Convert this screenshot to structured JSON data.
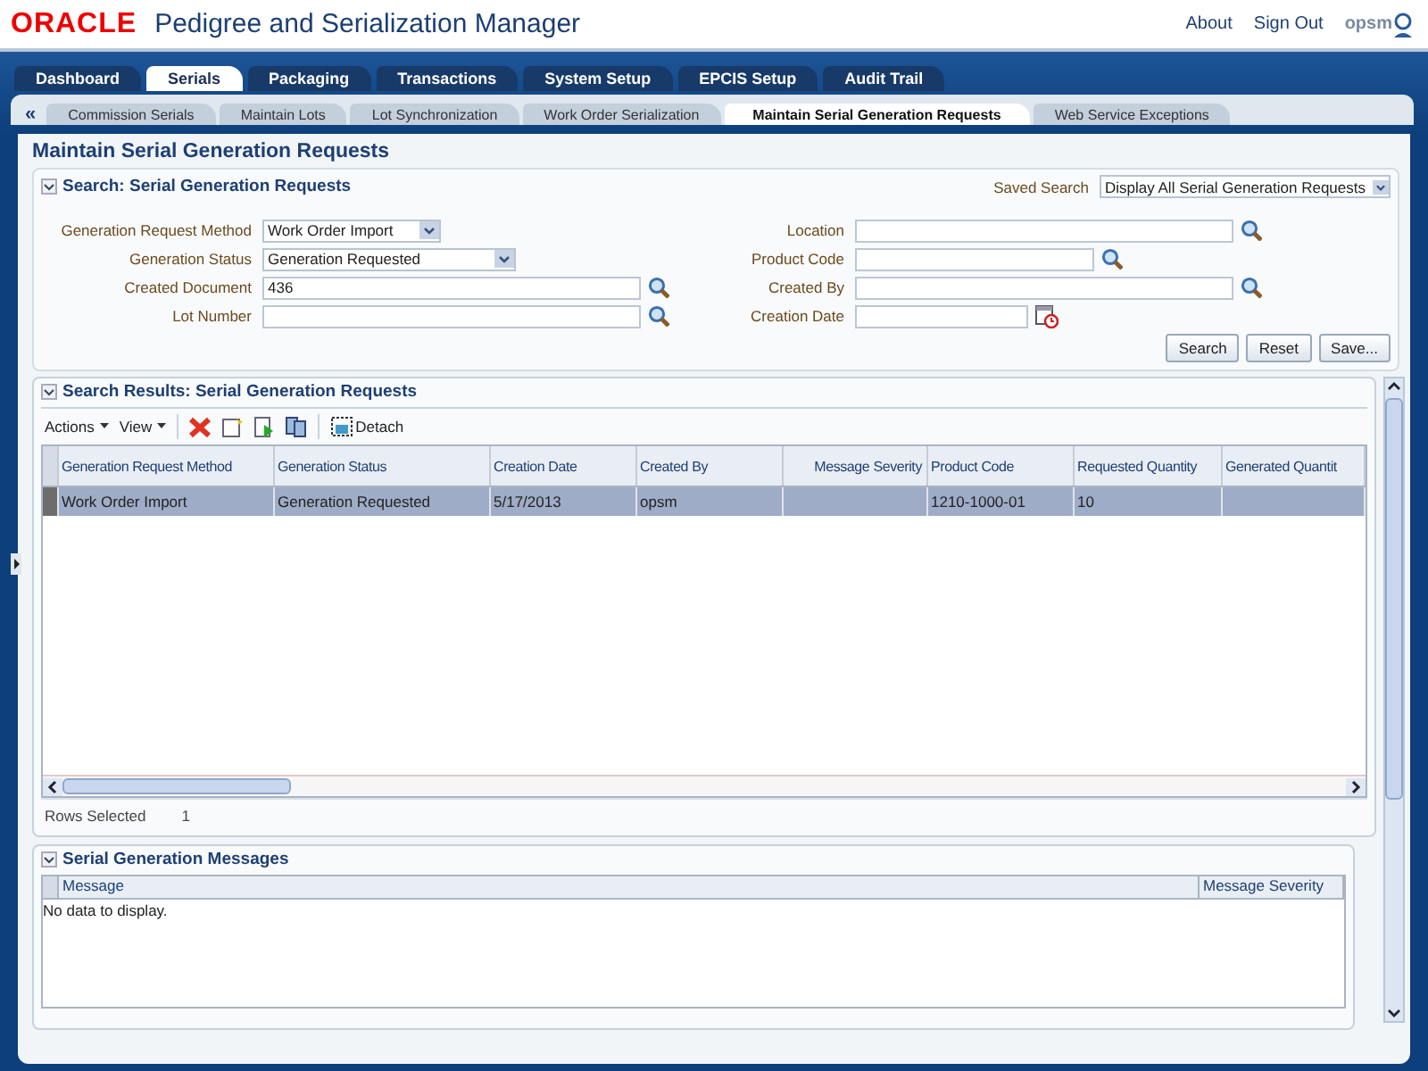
{
  "header": {
    "logo": "ORACLE",
    "title": "Pedigree and Serialization Manager",
    "links": [
      "About",
      "Sign Out"
    ],
    "user": "opsm"
  },
  "main_tabs": [
    {
      "label": "Dashboard",
      "selected": false
    },
    {
      "label": "Serials",
      "selected": true
    },
    {
      "label": "Packaging",
      "selected": false
    },
    {
      "label": "Transactions",
      "selected": false
    },
    {
      "label": "System Setup",
      "selected": false
    },
    {
      "label": "EPCIS Setup",
      "selected": false
    },
    {
      "label": "Audit Trail",
      "selected": false
    }
  ],
  "sub_tabs": {
    "scroll": "«",
    "items": [
      {
        "label": "Commission Serials",
        "selected": false
      },
      {
        "label": "Maintain Lots",
        "selected": false
      },
      {
        "label": "Lot Synchronization",
        "selected": false
      },
      {
        "label": "Work Order Serialization",
        "selected": false
      },
      {
        "label": "Maintain Serial Generation Requests",
        "selected": true
      },
      {
        "label": "Web Service Exceptions",
        "selected": false
      }
    ]
  },
  "page_title": "Maintain Serial Generation Requests",
  "search": {
    "title": "Search: Serial Generation Requests",
    "saved_search_label": "Saved Search",
    "saved_search_value": "Display All Serial Generation Requests",
    "left_fields": [
      {
        "label": "Generation Request Method",
        "kind": "select",
        "value": "Work Order Import"
      },
      {
        "label": "Generation Status",
        "kind": "select",
        "value": "Generation Requested"
      },
      {
        "label": "Created Document",
        "kind": "lookup",
        "value": "436"
      },
      {
        "label": "Lot Number",
        "kind": "lookup"
      }
    ],
    "right_fields": [
      {
        "label": "Location",
        "kind": "lookup"
      },
      {
        "label": "Product Code",
        "kind": "lookup"
      },
      {
        "label": "Created By",
        "kind": "lookup"
      },
      {
        "label": "Creation Date",
        "kind": "date"
      }
    ],
    "buttons": [
      "Search",
      "Reset",
      "Save..."
    ]
  },
  "results": {
    "title": "Search Results: Serial Generation Requests",
    "menus": [
      "Actions",
      "View"
    ],
    "detach": "Detach",
    "columns": [
      "Generation Request Method",
      "Generation Status",
      "Creation Date",
      "Created By",
      "Message Severity",
      "Product Code",
      "Requested Quantity",
      "Generated Quantit"
    ],
    "rows": [
      {
        "selected": true,
        "cells": [
          "Work Order Import",
          "Generation Requested",
          "5/17/2013",
          "opsm",
          null,
          "1210-1000-01",
          "10",
          null
        ]
      }
    ],
    "footer_label": "Rows Selected",
    "footer_value": "1"
  },
  "messages": {
    "title": "Serial Generation Messages",
    "columns": [
      "Message",
      "Message Severity"
    ],
    "empty_text": "No data to display."
  }
}
